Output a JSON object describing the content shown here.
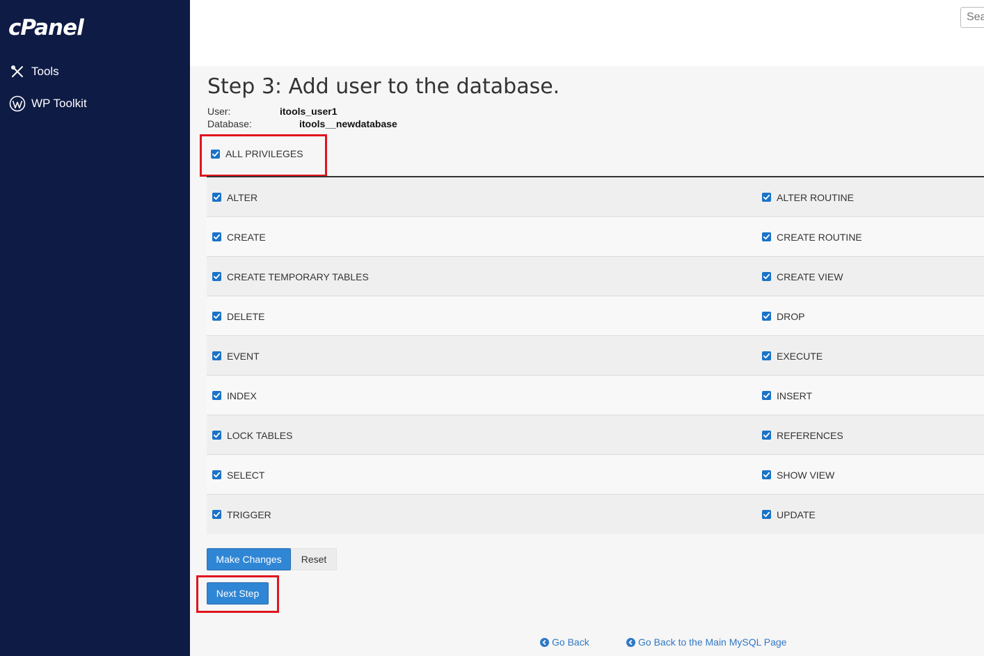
{
  "sidebar": {
    "logo": "cPanel",
    "items": [
      {
        "label": "Tools",
        "icon": "tools-icon"
      },
      {
        "label": "WP Toolkit",
        "icon": "wordpress-icon"
      }
    ]
  },
  "header": {
    "search_placeholder": "Sea"
  },
  "page": {
    "title": "Step 3: Add user to the database.",
    "user_label": "User:",
    "user_value": "itools_user1",
    "database_label": "Database:",
    "database_value": "itools__newdatabase",
    "all_privileges": {
      "label": "ALL PRIVILEGES",
      "checked": true
    }
  },
  "privileges": [
    {
      "left": "ALTER",
      "right": "ALTER ROUTINE"
    },
    {
      "left": "CREATE",
      "right": "CREATE ROUTINE"
    },
    {
      "left": "CREATE TEMPORARY TABLES",
      "right": "CREATE VIEW"
    },
    {
      "left": "DELETE",
      "right": "DROP"
    },
    {
      "left": "EVENT",
      "right": "EXECUTE"
    },
    {
      "left": "INDEX",
      "right": "INSERT"
    },
    {
      "left": "LOCK TABLES",
      "right": "REFERENCES"
    },
    {
      "left": "SELECT",
      "right": "SHOW VIEW"
    },
    {
      "left": "TRIGGER",
      "right": "UPDATE"
    }
  ],
  "buttons": {
    "make_changes": "Make Changes",
    "reset": "Reset",
    "next_step": "Next Step"
  },
  "links": {
    "go_back": "Go Back",
    "go_back_main": "Go Back to the Main MySQL Page"
  },
  "colors": {
    "sidebar_bg": "#0e1b44",
    "primary": "#2f86d4",
    "highlight": "#e0141e",
    "checkbox": "#1a73c8"
  }
}
